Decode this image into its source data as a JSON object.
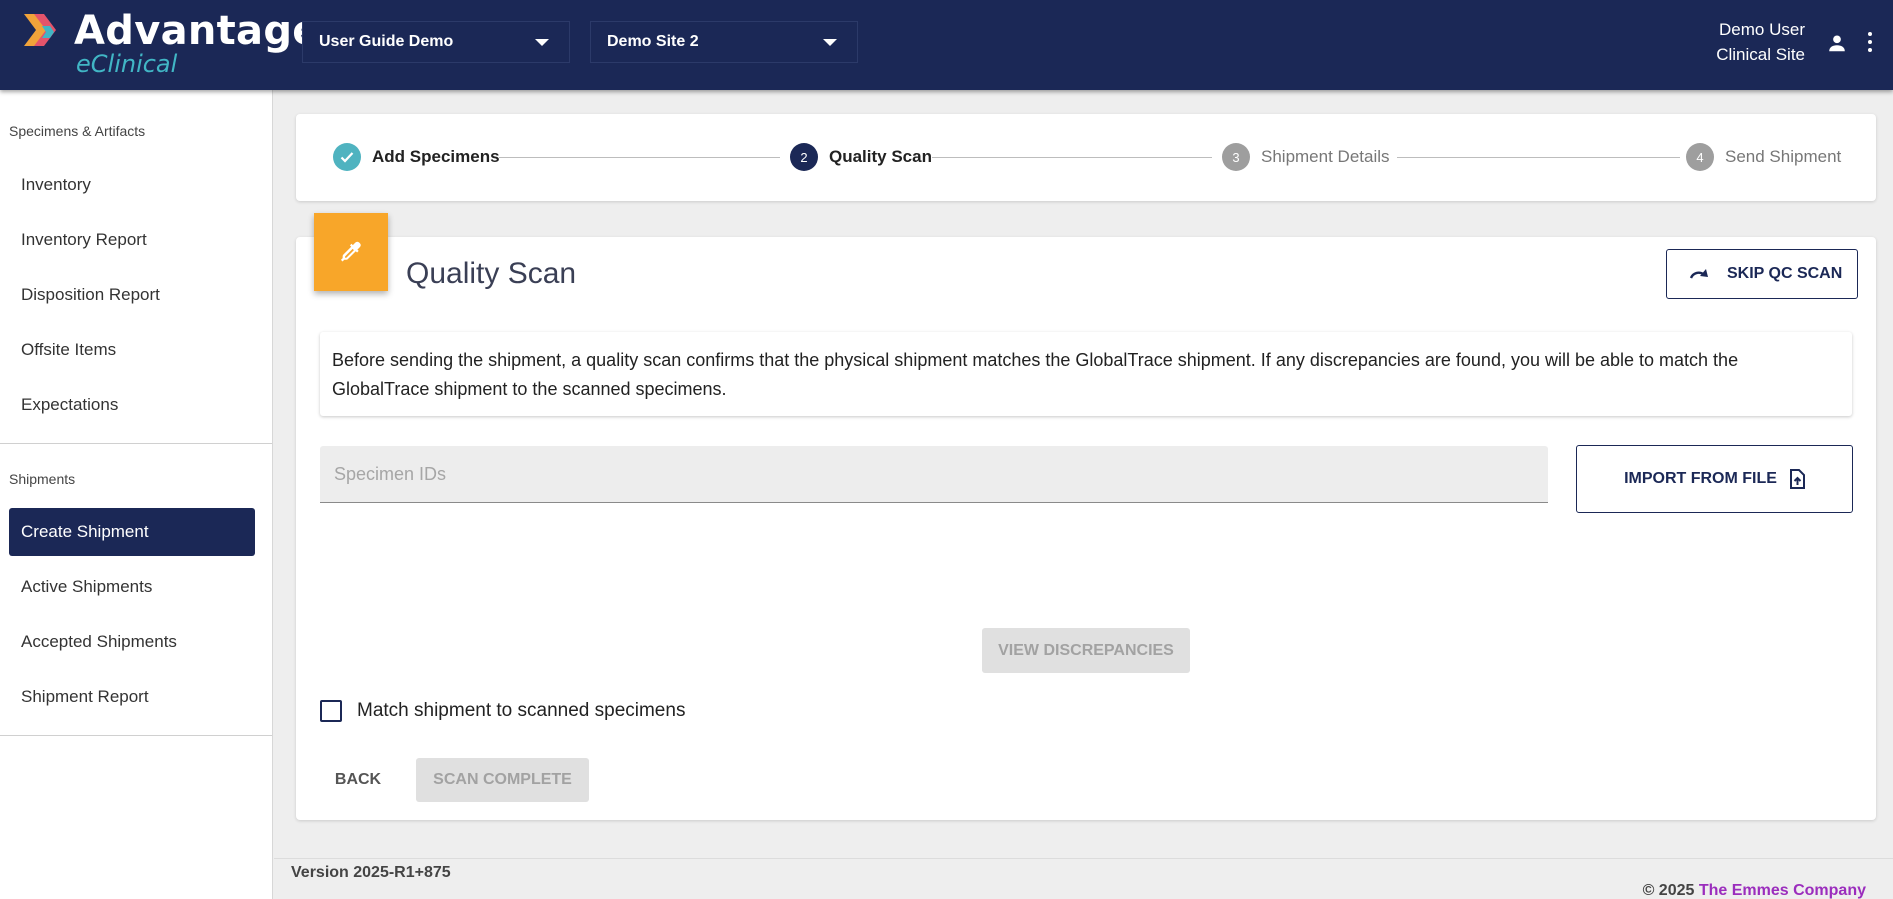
{
  "header": {
    "logo_title": "Advantage",
    "logo_subtitle": "eClinical",
    "study_select": "User Guide Demo",
    "site_select": "Demo Site 2",
    "user_name": "Demo User",
    "user_role": "Clinical Site"
  },
  "sidebar": {
    "section1_label": "Specimens & Artifacts",
    "section1_items": [
      {
        "label": "Inventory"
      },
      {
        "label": "Inventory Report"
      },
      {
        "label": "Disposition Report"
      },
      {
        "label": "Offsite Items"
      },
      {
        "label": "Expectations"
      }
    ],
    "section2_label": "Shipments",
    "section2_items": [
      {
        "label": "Create Shipment",
        "active": true
      },
      {
        "label": "Active Shipments"
      },
      {
        "label": "Accepted Shipments"
      },
      {
        "label": "Shipment Report"
      }
    ]
  },
  "stepper": {
    "steps": [
      {
        "number": "1",
        "label": "Add Specimens",
        "state": "completed"
      },
      {
        "number": "2",
        "label": "Quality Scan",
        "state": "active"
      },
      {
        "number": "3",
        "label": "Shipment Details",
        "state": "pending"
      },
      {
        "number": "4",
        "label": "Send Shipment",
        "state": "pending"
      }
    ]
  },
  "card": {
    "title": "Quality Scan",
    "skip_label": "SKIP QC SCAN",
    "info_text": "Before sending the shipment, a quality scan confirms that the physical shipment matches the GlobalTrace shipment. If any discrepancies are found, you will be able to match the GlobalTrace shipment to the scanned specimens.",
    "specimen_placeholder": "Specimen IDs",
    "specimen_value": "",
    "import_label": "IMPORT FROM FILE",
    "view_discrepancies_label": "VIEW DISCREPANCIES",
    "match_label": "Match shipment to scanned specimens",
    "match_checked": false,
    "back_label": "BACK",
    "scan_complete_label": "SCAN COMPLETE"
  },
  "footer": {
    "version": "Version 2025-R1+875",
    "copyright_prefix": "© 2025",
    "company": "The Emmes Company"
  },
  "colors": {
    "header_bg": "#1b2856",
    "accent_teal": "#41b6c5",
    "card_icon_orange": "#f8a629",
    "company_link": "#9b2dbd"
  },
  "icons": {
    "card_icon": "eyedropper-icon",
    "skip_icon": "redo-arrow-icon",
    "import_icon": "file-upload-icon",
    "user_icon": "person-icon",
    "menu_icon": "kebab-menu-icon",
    "step_done_icon": "check-icon"
  }
}
